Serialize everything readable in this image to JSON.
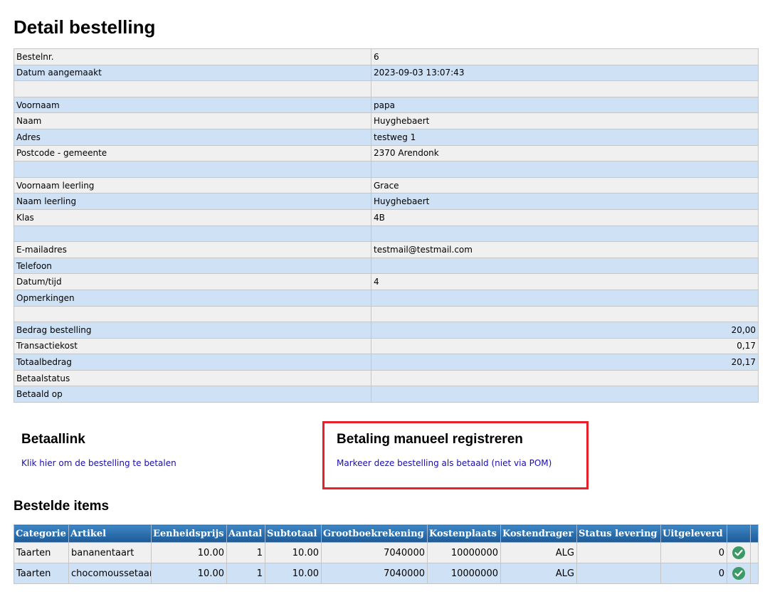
{
  "page": {
    "title": "Detail bestelling"
  },
  "detail_rows": [
    {
      "label": "Bestelnr.",
      "value": "6"
    },
    {
      "label": "Datum aangemaakt",
      "value": "2023-09-03 13:07:43"
    },
    {
      "label": "",
      "value": ""
    },
    {
      "label": "Voornaam",
      "value": "papa"
    },
    {
      "label": "Naam",
      "value": "Huyghebaert"
    },
    {
      "label": "Adres",
      "value": "testweg 1"
    },
    {
      "label": "Postcode - gemeente",
      "value": "2370 Arendonk"
    },
    {
      "label": "",
      "value": ""
    },
    {
      "label": "Voornaam leerling",
      "value": "Grace"
    },
    {
      "label": "Naam leerling",
      "value": "Huyghebaert"
    },
    {
      "label": "Klas",
      "value": "4B"
    },
    {
      "label": "",
      "value": ""
    },
    {
      "label": "E-mailadres",
      "value": "testmail@testmail.com"
    },
    {
      "label": "Telefoon",
      "value": ""
    },
    {
      "label": "Datum/tijd",
      "value": "4"
    },
    {
      "label": "Opmerkingen",
      "value": ""
    },
    {
      "label": "",
      "value": ""
    },
    {
      "label": "Bedrag bestelling",
      "value": "20,00",
      "numeric": true
    },
    {
      "label": "Transactiekost",
      "value": "0,17",
      "numeric": true
    },
    {
      "label": "Totaalbedrag",
      "value": "20,17",
      "numeric": true
    },
    {
      "label": "Betaalstatus",
      "value": ""
    },
    {
      "label": "Betaald op",
      "value": ""
    }
  ],
  "payment_link": {
    "title": "Betaallink",
    "link_text": "Klik hier om de bestelling te betalen"
  },
  "manual_payment": {
    "title": "Betaling manueel registreren",
    "link_text": "Markeer deze bestelling als betaald (niet via POM)",
    "highlight_color": "#e8202a"
  },
  "items": {
    "title": "Bestelde items",
    "columns": [
      "Categorie",
      "Artikel",
      "Eenheidsprijs",
      "Aantal",
      "Subtotaal",
      "Grootboekrekening",
      "Kostenplaats",
      "Kostendrager",
      "Status levering",
      "Uitgeleverd",
      "",
      ""
    ],
    "rows": [
      {
        "categorie": "Taarten",
        "artikel": "bananentaart",
        "eenheidsprijs": "10.00",
        "aantal": "1",
        "subtotaal": "10.00",
        "grootboekrekening": "7040000",
        "kostenplaats": "10000000",
        "kostendrager": "ALG",
        "status_levering": "",
        "uitgeleverd": "0",
        "icon": "check-circle-icon"
      },
      {
        "categorie": "Taarten",
        "artikel": "chocomoussetaart",
        "eenheidsprijs": "10.00",
        "aantal": "1",
        "subtotaal": "10.00",
        "grootboekrekening": "7040000",
        "kostenplaats": "10000000",
        "kostendrager": "ALG",
        "status_levering": "",
        "uitgeleverd": "0",
        "icon": "check-circle-icon"
      }
    ]
  },
  "colors": {
    "header_gradient_top": "#3e86c5",
    "header_gradient_bottom": "#1c5a97",
    "row_light": "#f0f0f0",
    "row_blue": "#cfe1f5",
    "link": "#1a0dab",
    "check_green": "#3d9a66"
  }
}
